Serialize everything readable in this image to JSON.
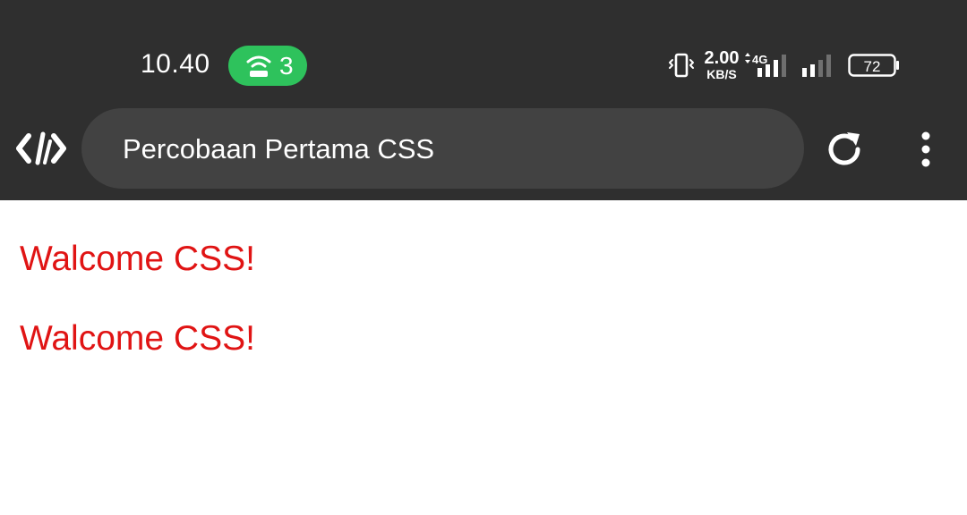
{
  "status_bar": {
    "time": "10.40",
    "hotspot_count": "3",
    "net_speed_value": "2.00",
    "net_speed_unit": "KB/S",
    "network_type": "4G",
    "battery_level": "72",
    "colors": {
      "hotspot_pill": "#2ec25c",
      "bar_bg": "#2f2f2f"
    },
    "icons": [
      "hotspot-icon",
      "vibrate-icon",
      "signal-icon",
      "battery-icon"
    ]
  },
  "browser": {
    "page_title": "Percobaan Pertama CSS",
    "icons": [
      "code-logo-icon",
      "reload-icon",
      "more-vert-icon"
    ],
    "colors": {
      "url_bar_bg": "#424242"
    }
  },
  "content": {
    "headings": [
      "Walcome CSS!",
      "Walcome CSS!"
    ],
    "colors": {
      "heading_text": "#e01414"
    }
  }
}
